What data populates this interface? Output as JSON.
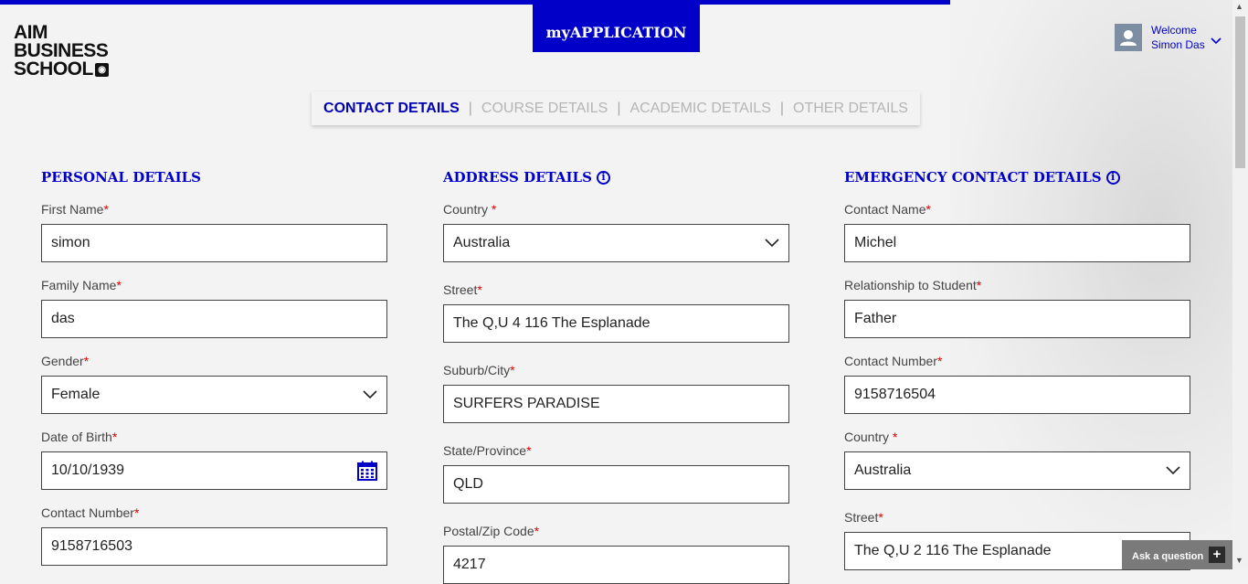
{
  "brand": {
    "logo_line1": "AIM",
    "logo_line2": "BUSINESS",
    "logo_line3": "SCHOOL"
  },
  "app_tab": {
    "label": "myAPPLICATION"
  },
  "user": {
    "welcome": "Welcome",
    "name": "Simon Das"
  },
  "tabs": [
    {
      "label": "CONTACT DETAILS",
      "active": true
    },
    {
      "label": "COURSE DETAILS",
      "active": false
    },
    {
      "label": "ACADEMIC DETAILS",
      "active": false
    },
    {
      "label": "OTHER DETAILS",
      "active": false
    }
  ],
  "tab_separator": "|",
  "required_mark": "*",
  "personal": {
    "title": "PERSONAL DETAILS",
    "first_name": {
      "label": "First Name",
      "value": "simon"
    },
    "family_name": {
      "label": "Family Name",
      "value": "das"
    },
    "gender": {
      "label": "Gender",
      "value": "Female"
    },
    "dob": {
      "label": "Date of Birth",
      "value": "10/10/1939"
    },
    "contact_number": {
      "label": "Contact Number",
      "value": "9158716503"
    }
  },
  "address": {
    "title": "ADDRESS DETAILS",
    "country": {
      "label": "Country ",
      "value": "Australia"
    },
    "street": {
      "label": "Street",
      "value": "The Q,U 4  116 The Esplanade"
    },
    "suburb": {
      "label": "Suburb/City",
      "value": "SURFERS PARADISE"
    },
    "state": {
      "label": "State/Province",
      "value": "QLD"
    },
    "postal": {
      "label": "Postal/Zip Code",
      "value": "4217"
    }
  },
  "emergency": {
    "title": "EMERGENCY CONTACT DETAILS",
    "contact_name": {
      "label": "Contact Name",
      "value": "Michel"
    },
    "relationship": {
      "label": "Relationship to Student",
      "value": "Father"
    },
    "contact_number": {
      "label": "Contact Number",
      "value": "9158716504"
    },
    "country": {
      "label": "Country ",
      "value": "Australia"
    },
    "street": {
      "label": "Street",
      "value": "The Q,U 2  116 The Esplanade"
    }
  },
  "info_glyph": "i",
  "chat": {
    "label": "Ask a question",
    "plus": "+"
  },
  "colors": {
    "primary": "#0000c8",
    "required": "#e00000",
    "inactive_tab": "#b5b5b5"
  }
}
